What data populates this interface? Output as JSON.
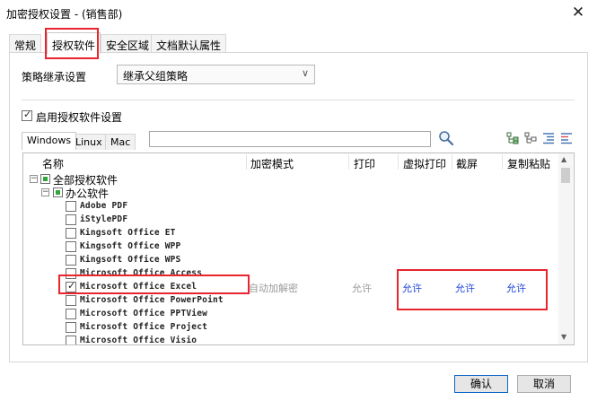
{
  "window": {
    "title": "加密授权设置 - (销售部)",
    "close_glyph": "✕"
  },
  "tabs": [
    {
      "label": "常规"
    },
    {
      "label": "授权软件",
      "active": true
    },
    {
      "label": "安全区域"
    },
    {
      "label": "文档默认属性"
    }
  ],
  "policy": {
    "label": "策略继承设置",
    "value": "继承父组策略"
  },
  "enable": {
    "label": "启用授权软件设置",
    "checked": true
  },
  "os_tabs": [
    {
      "label": "Windows",
      "active": true
    },
    {
      "label": "Linux"
    },
    {
      "label": "Mac"
    }
  ],
  "search": {
    "value": "",
    "placeholder": ""
  },
  "list": {
    "columns": [
      "名称",
      "加密模式",
      "打印",
      "虚拟打印",
      "截屏",
      "复制粘贴"
    ],
    "tree": {
      "root": "全部授权软件",
      "group": "办公软件"
    },
    "items": [
      {
        "name": "Adobe PDF",
        "checked": false
      },
      {
        "name": "iStylePDF",
        "checked": false
      },
      {
        "name": "Kingsoft Office ET",
        "checked": false
      },
      {
        "name": "Kingsoft Office WPP",
        "checked": false
      },
      {
        "name": "Kingsoft Office WPS",
        "checked": false
      },
      {
        "name": "Microsoft Office Access",
        "checked": false
      },
      {
        "name": "Microsoft Office Excel",
        "checked": true,
        "mode": "自动加解密",
        "print": "允许",
        "virtual_print": "允许",
        "screenshot": "允许",
        "copy_paste": "允许"
      },
      {
        "name": "Microsoft Office PowerPoint",
        "checked": false
      },
      {
        "name": "Microsoft Office PPTView",
        "checked": false
      },
      {
        "name": "Microsoft Office Project",
        "checked": false
      },
      {
        "name": "Microsoft Office Visio",
        "checked": false
      }
    ]
  },
  "buttons": {
    "ok": "确认",
    "cancel": "取消"
  },
  "colors": {
    "highlight_box": "#e8242c",
    "allow_text": "#2046d8",
    "tree_check_fill": "#2fa63a"
  }
}
